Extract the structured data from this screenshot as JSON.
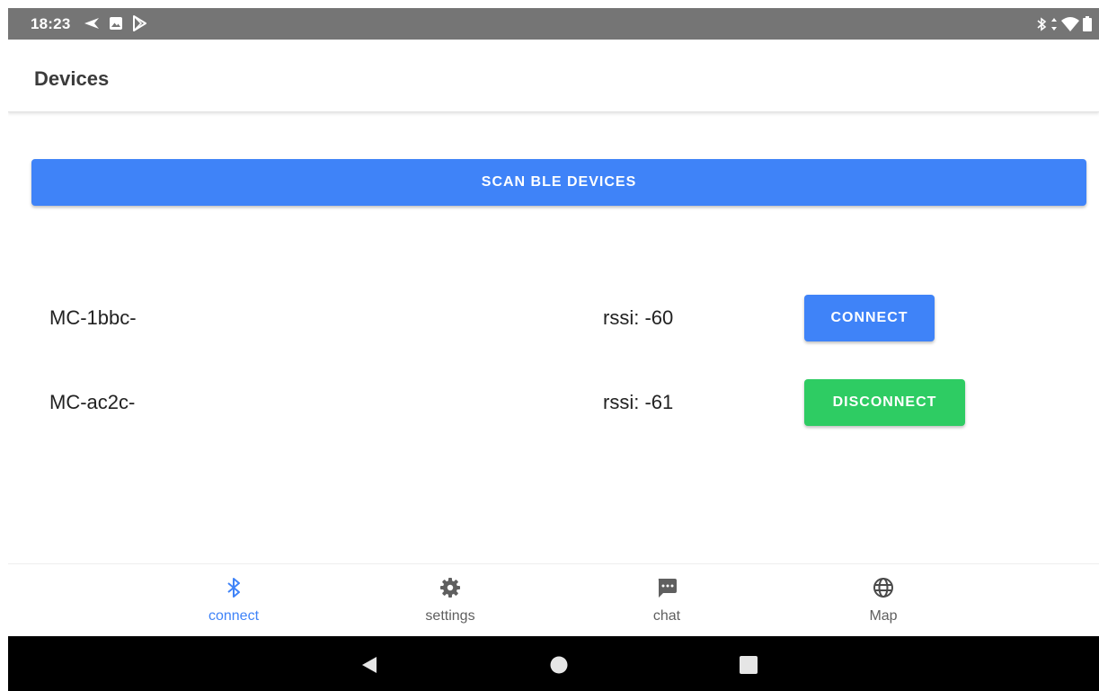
{
  "status_bar": {
    "time": "18:23",
    "left_icons": [
      "navigation-arrow-icon",
      "image-icon",
      "play-store-icon"
    ],
    "right_icons": [
      "bluetooth-icon",
      "data-arrows-icon",
      "wifi-icon",
      "battery-icon"
    ]
  },
  "app_bar": {
    "title": "Devices"
  },
  "scan": {
    "label": "SCAN BLE DEVICES"
  },
  "devices": [
    {
      "name": "MC-1bbc-",
      "rssi": "rssi: -60",
      "action": "CONNECT"
    },
    {
      "name": "MC-ac2c-",
      "rssi": "rssi: -61",
      "action": "DISCONNECT"
    }
  ],
  "bottom_nav": {
    "items": [
      {
        "label": "connect",
        "icon": "bluetooth-icon",
        "active": true
      },
      {
        "label": "settings",
        "icon": "gear-icon",
        "active": false
      },
      {
        "label": "chat",
        "icon": "chat-bubble-icon",
        "active": false
      },
      {
        "label": "Map",
        "icon": "globe-icon",
        "active": false
      }
    ]
  },
  "system_nav": {
    "buttons": [
      "back-icon",
      "home-icon",
      "recents-icon"
    ]
  },
  "colors": {
    "status_bar": "#757575",
    "primary": "#3f83f8",
    "success": "#2ecc63",
    "system_nav": "#000000"
  }
}
